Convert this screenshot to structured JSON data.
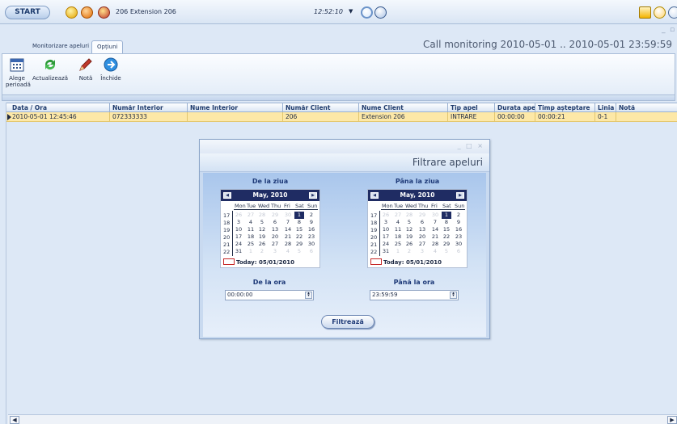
{
  "topbar": {
    "start_label": "START",
    "extension_label": "206 Extension 206",
    "clock": "12:52:10",
    "clock_arrow": "▼"
  },
  "tabs": [
    {
      "label": "Monitorizare apeluri"
    },
    {
      "label": "Opțiuni"
    }
  ],
  "window_title": "Call monitoring 2010-05-01 .. 2010-05-01 23:59:59",
  "ribbon": {
    "buttons": [
      {
        "label_line1": "Alege",
        "label_line2": "perioadă",
        "icon": "calendar-icon"
      },
      {
        "label": "Actualizează",
        "icon": "refresh-icon"
      },
      {
        "label": "Notă",
        "icon": "pencil-icon"
      },
      {
        "label": "Închide",
        "icon": "arrow-right-icon"
      }
    ]
  },
  "grid": {
    "columns": [
      "Data / Ora",
      "Număr Interior",
      "Nume Interior",
      "Număr Client",
      "Nume Client",
      "Tip apel",
      "Durata apel",
      "Timp așteptare",
      "Linia",
      "Notă"
    ],
    "rows": [
      {
        "data_ora": "2010-05-01   12:45:46",
        "numar_interior": "072333333",
        "nume_interior": "",
        "numar_client": "206",
        "nume_client": "Extension 206",
        "tip_apel": "INTRARE",
        "durata": "00:00:00",
        "asteptare": "00:00:21",
        "linia": "0-1",
        "nota": ""
      }
    ]
  },
  "dialog": {
    "title": "Filtrare apeluri",
    "window_controls": "_ □ ×",
    "from_label": "De la ziua",
    "to_label": "Pâna la ziua",
    "calendar": {
      "month_label": "May, 2010",
      "dow": [
        "Mon",
        "Tue",
        "Wed",
        "Thu",
        "Fri",
        "Sat",
        "Sun"
      ],
      "weeks": [
        "17",
        "18",
        "19",
        "20",
        "21",
        "22"
      ],
      "days": [
        [
          "26",
          "27",
          "28",
          "29",
          "30",
          "1",
          "2"
        ],
        [
          "3",
          "4",
          "5",
          "6",
          "7",
          "8",
          "9"
        ],
        [
          "10",
          "11",
          "12",
          "13",
          "14",
          "15",
          "16"
        ],
        [
          "17",
          "18",
          "19",
          "20",
          "21",
          "22",
          "23"
        ],
        [
          "24",
          "25",
          "26",
          "27",
          "28",
          "29",
          "30"
        ],
        [
          "31",
          "1",
          "2",
          "3",
          "4",
          "5",
          "6"
        ]
      ],
      "today_label": "Today: 05/01/2010",
      "nav_prev": "◀",
      "nav_next": "▶"
    },
    "from_time_label": "De la ora",
    "to_time_label": "Până la ora",
    "from_time_value": "00:00:00",
    "to_time_value": "23:59:59",
    "filter_button": "Filtrează"
  },
  "colors": {
    "accent": "#1f2c63",
    "row_highlight": "#fde8a7",
    "background": "#dde8f6"
  }
}
